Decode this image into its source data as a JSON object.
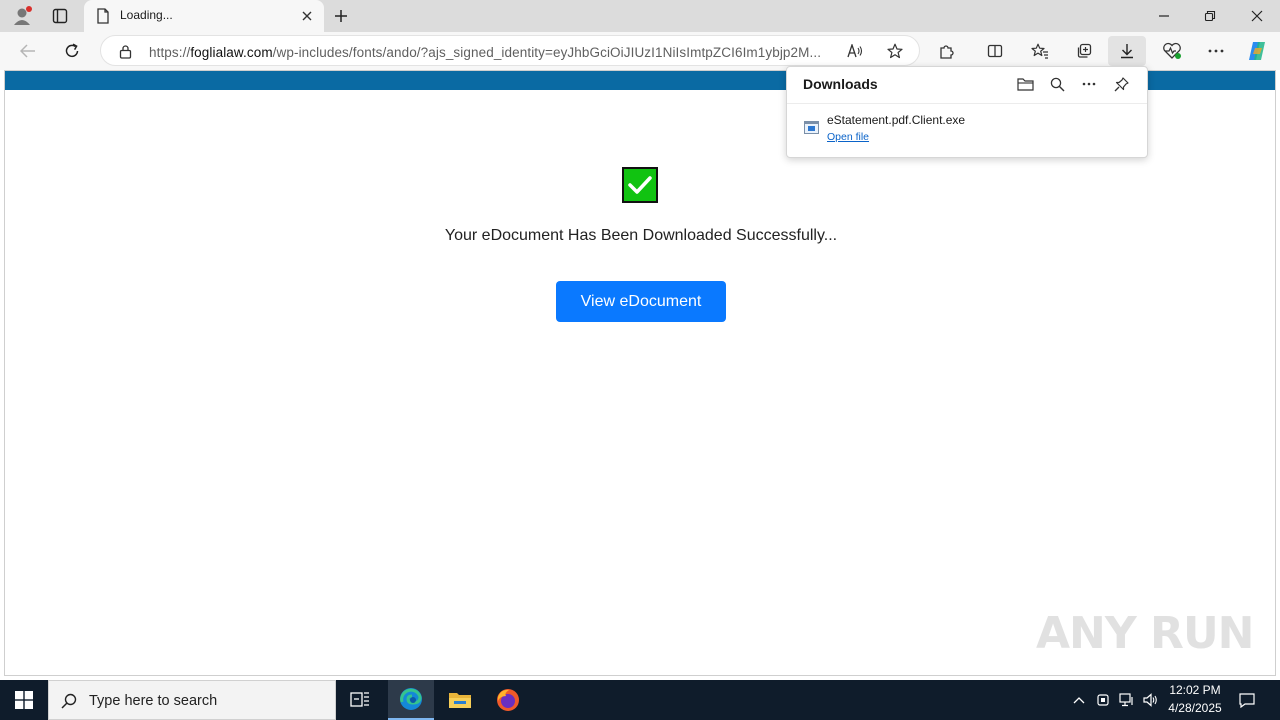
{
  "browser": {
    "tab": {
      "title": "Loading..."
    },
    "address": {
      "scheme": "https://",
      "host": "foglialaw.com",
      "path": "/wp-includes/fonts/ando/?ajs_signed_identity=eyJhbGciOiJIUzI1NiIsImtpZCI6Im1ybjp2M..."
    },
    "downloads_panel": {
      "title": "Downloads",
      "items": [
        {
          "filename": "eStatement.pdf.Client.exe",
          "action": "Open file"
        }
      ]
    }
  },
  "page": {
    "message": "Your eDocument Has Been Downloaded Successfully...",
    "button_label": "View eDocument",
    "band_color": "#0a6aa3",
    "button_color": "#0a79ff",
    "check_color": "#11c311"
  },
  "watermark": "ANY RUN",
  "taskbar": {
    "search_placeholder": "Type here to search",
    "time": "12:02 PM",
    "date": "4/28/2025",
    "pinned_apps": [
      "task-view-icon",
      "edge-icon",
      "file-explorer-icon",
      "firefox-icon"
    ]
  }
}
